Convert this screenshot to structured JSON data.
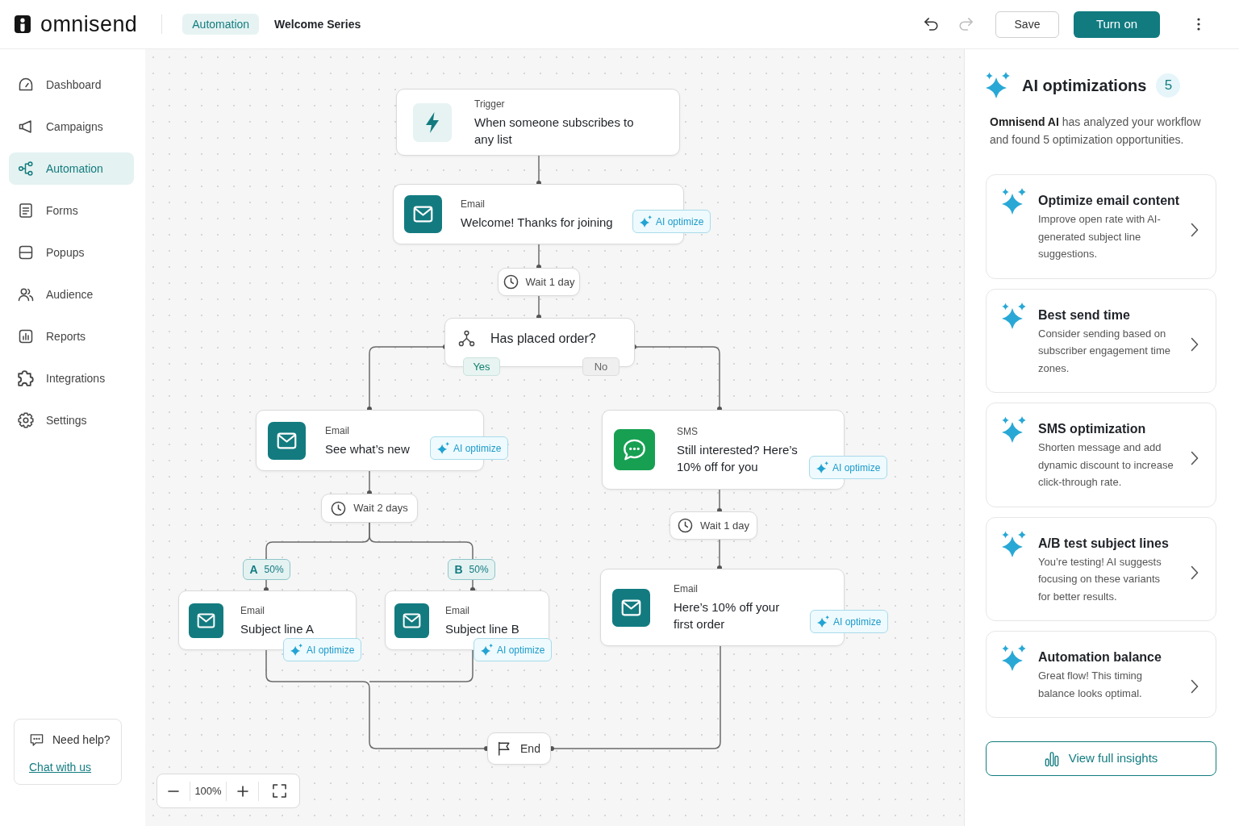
{
  "header": {
    "brand": "omnisend",
    "breadcrumb": [
      {
        "kind": "link",
        "label": "Automation"
      },
      {
        "kind": "current",
        "label": "Welcome Series"
      }
    ],
    "history": [
      {
        "kind": "undo",
        "disabled": false
      },
      {
        "kind": "redo",
        "disabled": true
      }
    ],
    "buttons": [
      {
        "kind": "secondary",
        "label": "Save"
      },
      {
        "kind": "primary",
        "label": "Turn on"
      }
    ]
  },
  "sidebar": {
    "items": [
      {
        "label": "Dashboard",
        "selected": false
      },
      {
        "label": "Campaigns",
        "selected": false
      },
      {
        "label": "Automation",
        "selected": true
      },
      {
        "label": "Forms",
        "selected": false
      },
      {
        "label": "Popups",
        "selected": false
      },
      {
        "label": "Audience",
        "selected": false
      },
      {
        "label": "Reports",
        "selected": false
      },
      {
        "label": "Integrations",
        "selected": false
      },
      {
        "label": "Settings",
        "selected": false
      }
    ],
    "help": {
      "title": "Need help?",
      "link": "Chat with us"
    }
  },
  "canvas": {
    "nodes": [
      {
        "kind": "trigger",
        "label": "Trigger",
        "title": "When someone subscribes to any list"
      },
      {
        "kind": "email",
        "label": "Email",
        "title": "Welcome! Thanks for joining",
        "ai_action": "AI optimize"
      },
      {
        "kind": "wait",
        "label": "Wait 1 day"
      },
      {
        "kind": "condition",
        "title": "Has placed order?",
        "branches": [
          {
            "kind": "yes",
            "label": "Yes"
          },
          {
            "kind": "no",
            "label": "No"
          }
        ]
      },
      {
        "kind": "email",
        "label": "Email",
        "title": "See what’s new",
        "ai_action": "AI optimize"
      },
      {
        "kind": "sms",
        "label": "SMS",
        "title": "Still interested? Here’s 10% off for you",
        "ai_action": "AI optimize"
      },
      {
        "kind": "wait",
        "label": "Wait 2 days"
      },
      {
        "kind": "wait",
        "label": "Wait 1 day"
      },
      {
        "kind": "split",
        "variant": "A",
        "share": "50%"
      },
      {
        "kind": "split",
        "variant": "B",
        "share": "50%"
      },
      {
        "kind": "email",
        "label": "Email",
        "title": "Subject line A",
        "ai_action": "AI optimize"
      },
      {
        "kind": "email",
        "label": "Email",
        "title": "Subject line B",
        "ai_action": "AI optimize"
      },
      {
        "kind": "email",
        "label": "Email",
        "title": "Here’s 10% off your first order",
        "ai_action": "AI optimize"
      },
      {
        "kind": "end",
        "label": "End"
      }
    ],
    "zoom_level": "100%"
  },
  "ai_panel": {
    "title": "AI optimizations",
    "count": "5",
    "description": "**Omnisend AI** has analyzed your workflow and found 5 optimization opportunities.",
    "suggestions": [
      {
        "title": "Optimize email content",
        "description": "Improve open rate with AI-generated subject line suggestions."
      },
      {
        "title": "Best send time",
        "description": "Consider sending based on subscriber engagement time zones."
      },
      {
        "title": "SMS optimization",
        "description": "Shorten message and add dynamic discount to increase click-through rate."
      },
      {
        "title": "A/B test subject lines",
        "description": "You’re testing! AI suggests focusing on these variants for better results."
      },
      {
        "title": "Automation balance",
        "description": "Great flow! This timing balance looks optimal."
      }
    ],
    "insights_button": "View full insights"
  }
}
